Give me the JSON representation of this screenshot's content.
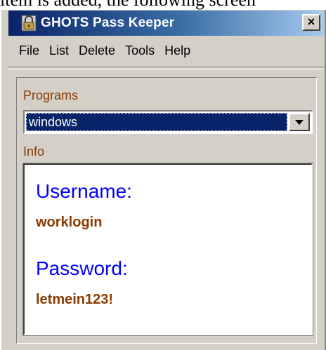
{
  "document_fragment": "item is added, the following screen",
  "window": {
    "title": "GHOTS Pass Keeper",
    "title_icon": "lock-icon",
    "close_label": "×"
  },
  "menu": {
    "items": [
      {
        "label": "File"
      },
      {
        "label": "List"
      },
      {
        "label": "Delete"
      },
      {
        "label": "Tools"
      },
      {
        "label": "Help"
      }
    ]
  },
  "programs": {
    "label": "Programs",
    "selected": "windows",
    "dropdown_icon": "chevron-down-icon"
  },
  "info": {
    "label": "Info",
    "username_label": "Username:",
    "username_value": "worklogin",
    "password_label": "Password:",
    "password_value": "letmein123!"
  },
  "colors": {
    "title_start": "#0a246a",
    "title_end": "#a6caf0",
    "label_brown": "#8b3a00",
    "field_blue": "#0000ff",
    "selection": "#0a246a"
  }
}
